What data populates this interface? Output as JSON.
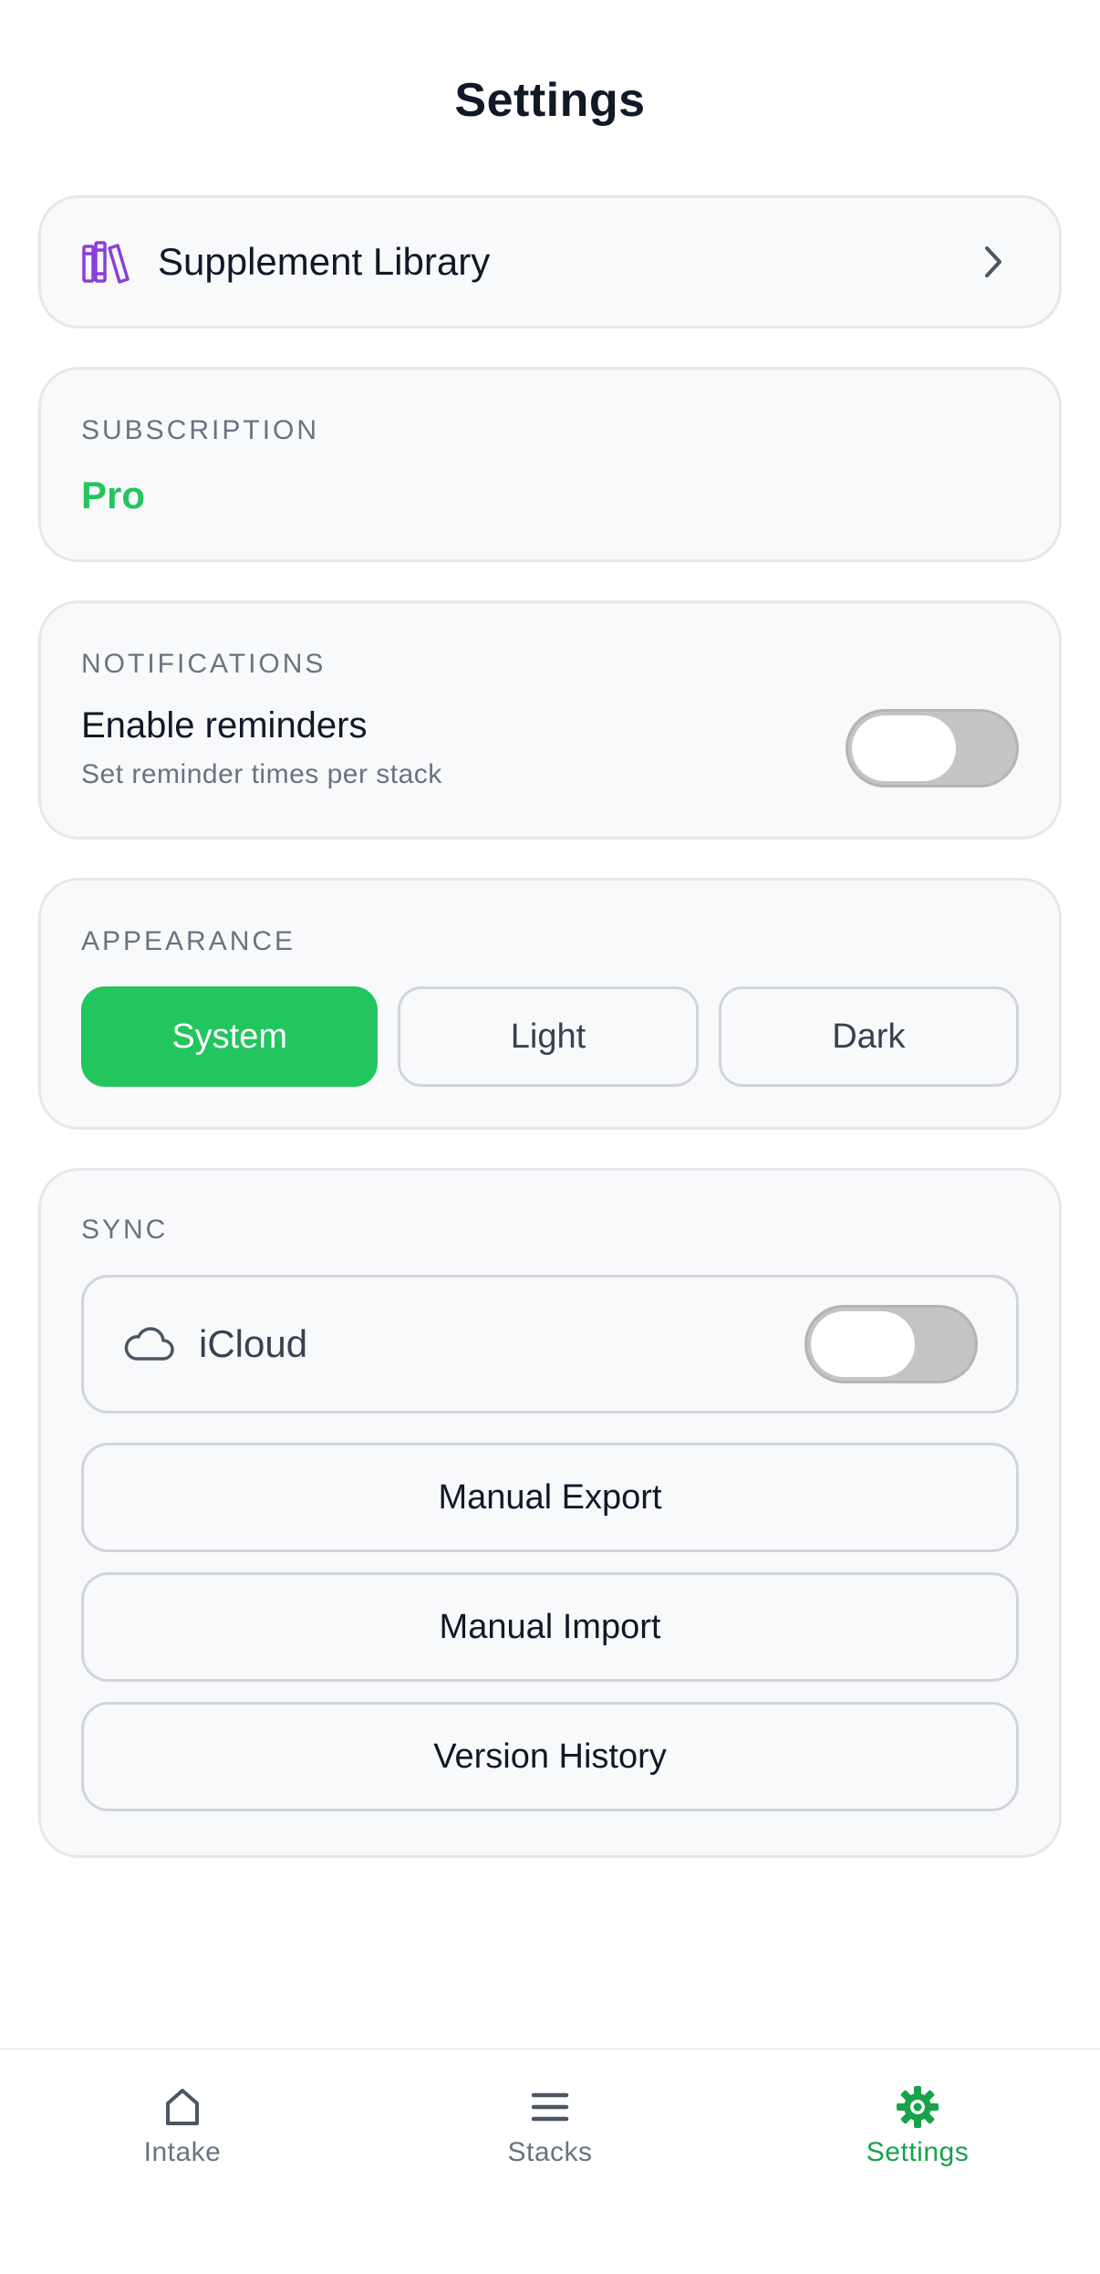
{
  "header": {
    "title": "Settings"
  },
  "library": {
    "label": "Supplement Library",
    "icon": "books-icon"
  },
  "subscription": {
    "section_label": "SUBSCRIPTION",
    "plan": "Pro",
    "plan_color": "#22c55e"
  },
  "notifications": {
    "section_label": "NOTIFICATIONS",
    "title": "Enable reminders",
    "subtitle": "Set reminder times per stack",
    "enabled": false
  },
  "appearance": {
    "section_label": "APPEARANCE",
    "options": [
      "System",
      "Light",
      "Dark"
    ],
    "selected": "System",
    "accent": "#22c55e"
  },
  "sync": {
    "section_label": "SYNC",
    "icloud_label": "iCloud",
    "icloud_enabled": false,
    "buttons": {
      "export": "Manual Export",
      "import": "Manual Import",
      "history": "Version History"
    }
  },
  "tabbar": {
    "tabs": [
      {
        "label": "Intake",
        "icon": "home-icon"
      },
      {
        "label": "Stacks",
        "icon": "menu-icon"
      },
      {
        "label": "Settings",
        "icon": "gear-icon"
      }
    ],
    "active": "Settings",
    "active_color": "#16a34a"
  }
}
